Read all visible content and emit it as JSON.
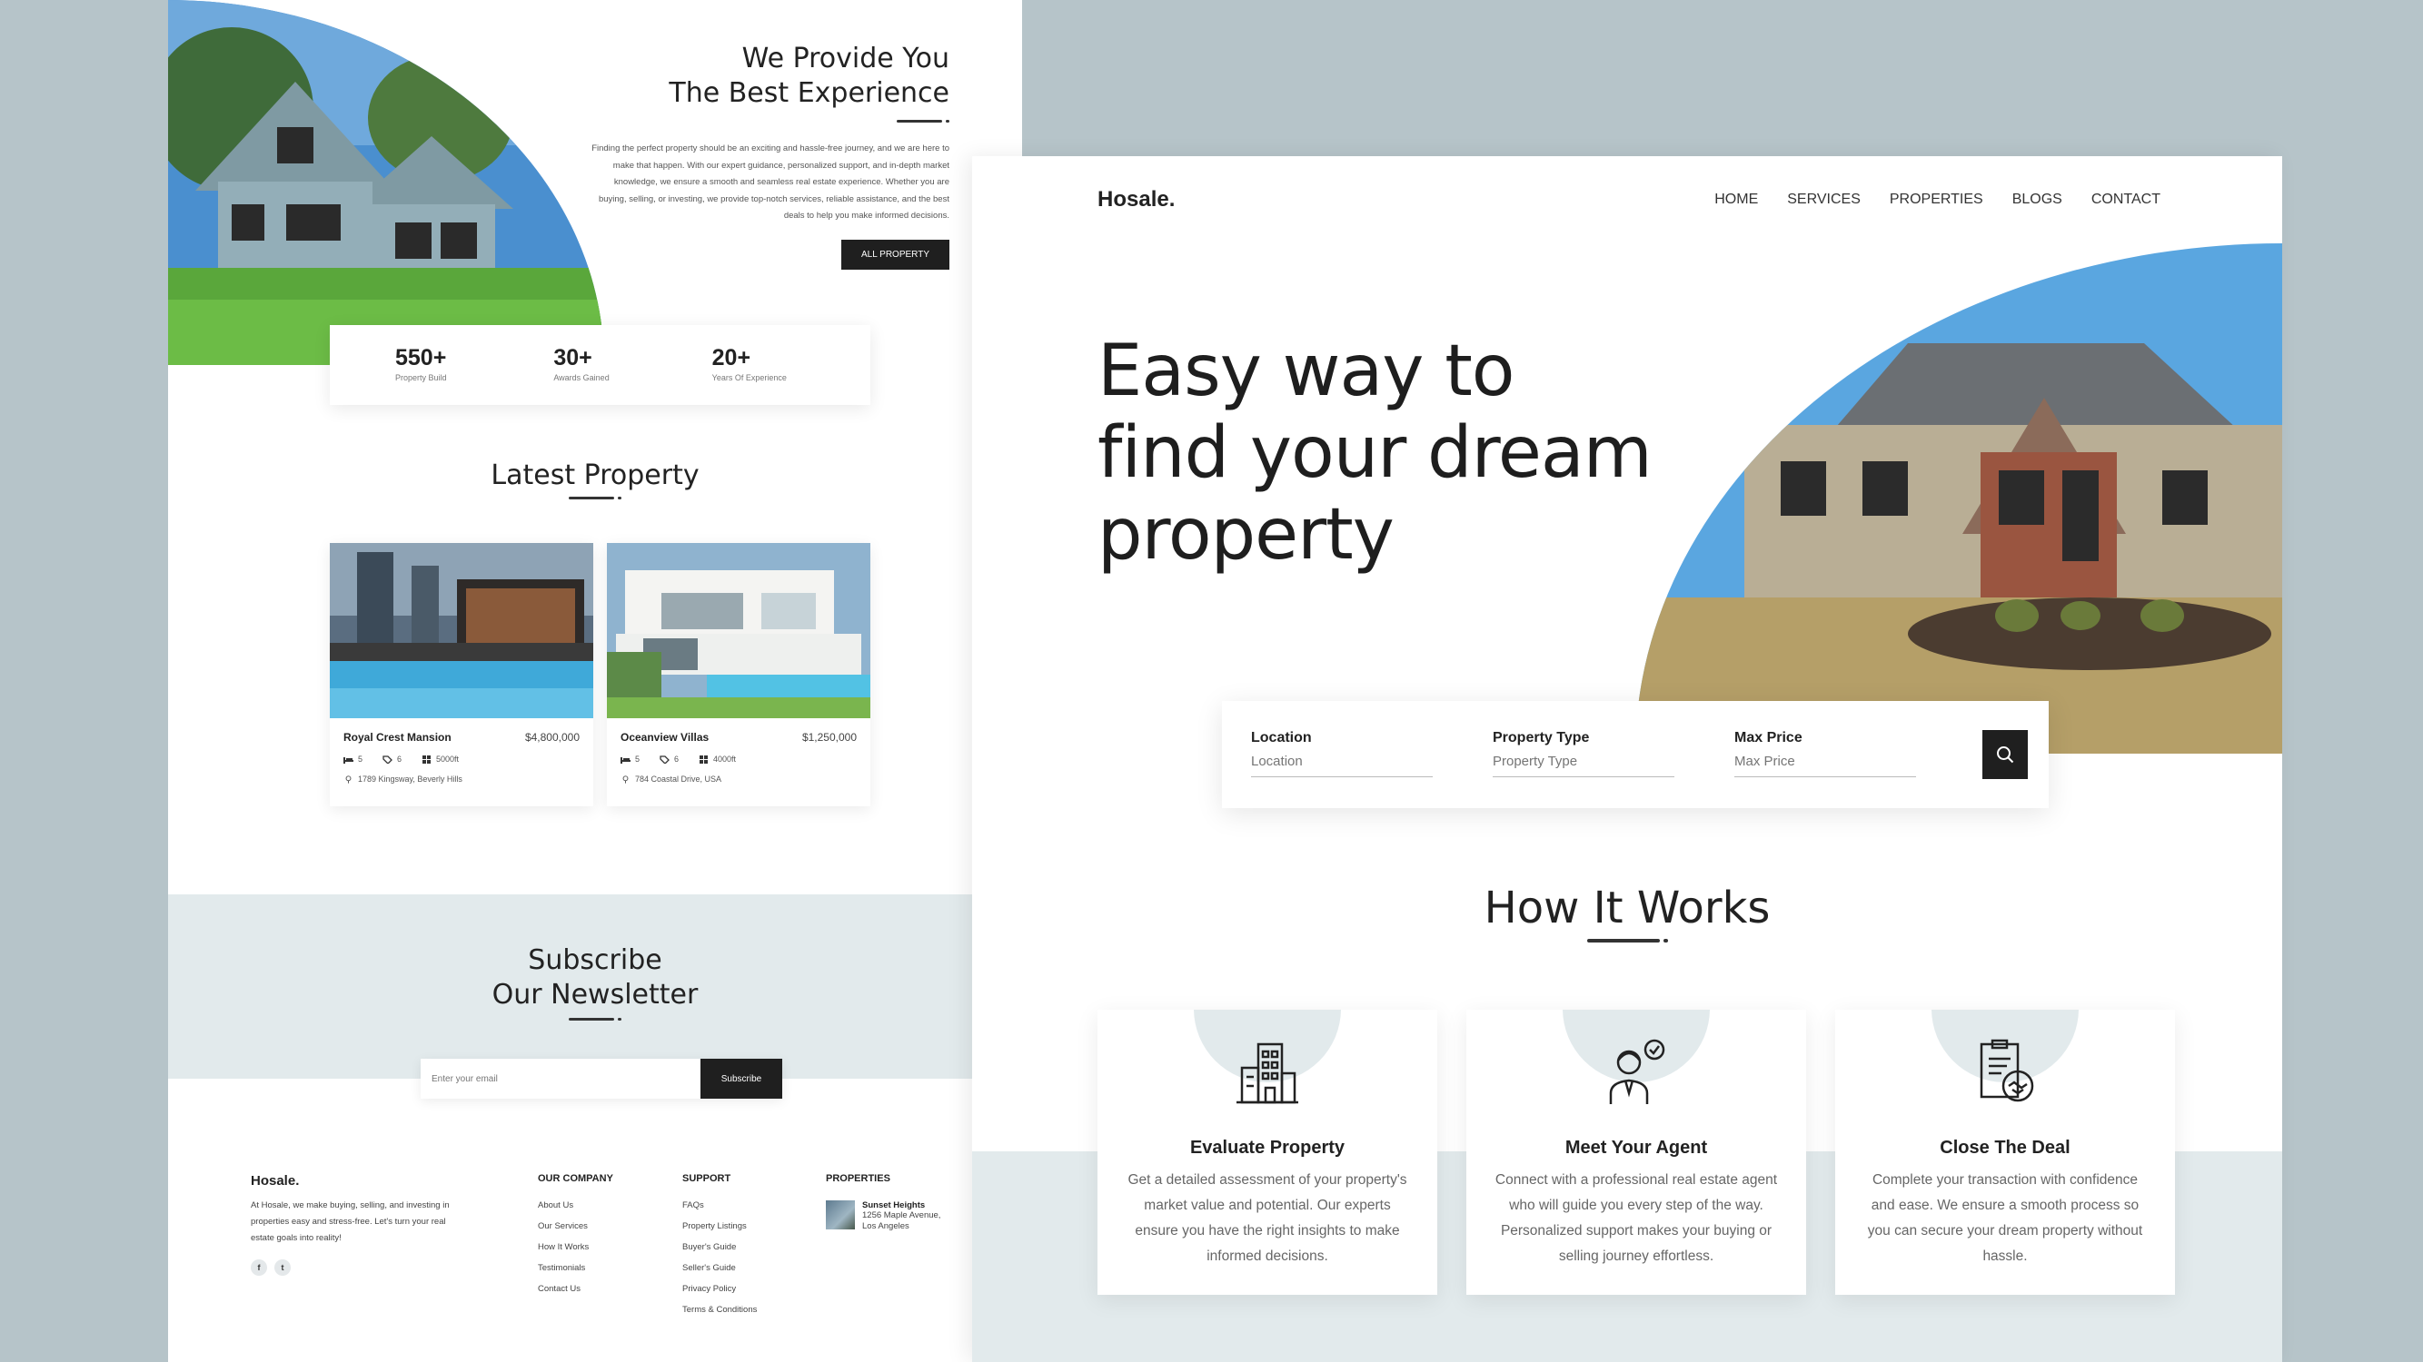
{
  "left_page": {
    "about": {
      "title_line1": "We Provide You",
      "title_line2": "The Best Experience",
      "paragraph": "Finding the perfect property should be an exciting and hassle-free journey, and we are here to make that happen. With our expert guidance, personalized support, and in-depth market knowledge, we ensure a smooth and seamless real estate experience. Whether you are buying, selling, or investing, we provide top-notch services, reliable assistance, and the best deals to help you make informed decisions.",
      "button_label": "ALL PROPERTY"
    },
    "stats": [
      {
        "value": "550+",
        "label": "Property Build"
      },
      {
        "value": "30+",
        "label": "Awards Gained"
      },
      {
        "value": "20+",
        "label": "Years Of Experience"
      }
    ],
    "latest": {
      "title": "Latest Property",
      "cards": [
        {
          "name": "Royal Crest Mansion",
          "price": "$4,800,000",
          "beds": "5",
          "baths": "6",
          "area": "5000ft",
          "address": "1789 Kingsway, Beverly Hills"
        },
        {
          "name": "Oceanview Villas",
          "price": "$1,250,000",
          "beds": "5",
          "baths": "6",
          "area": "4000ft",
          "address": "784 Coastal Drive, USA"
        }
      ]
    },
    "newsletter": {
      "title_line1": "Subscribe",
      "title_line2": "Our Newsletter",
      "placeholder": "Enter your email",
      "button_label": "Subscribe"
    },
    "footer": {
      "logo": "Hosale.",
      "description": "At Hosale, we make buying, selling, and investing in properties easy and stress-free. Let's turn your real estate goals into reality!",
      "social": [
        "f",
        "t"
      ],
      "company": {
        "heading": "OUR COMPANY",
        "links": [
          "About Us",
          "Our Services",
          "How It Works",
          "Testimonials",
          "Contact Us"
        ]
      },
      "support": {
        "heading": "SUPPORT",
        "links": [
          "FAQs",
          "Property Listings",
          "Buyer's Guide",
          "Seller's Guide",
          "Privacy Policy",
          "Terms & Conditions"
        ]
      },
      "properties": {
        "heading": "PROPERTIES",
        "item_title": "Sunset Heights",
        "item_address_line1": "1256 Maple Avenue,",
        "item_address_line2": "Los Angeles"
      }
    }
  },
  "right_page": {
    "logo": "Hosale.",
    "nav": [
      "HOME",
      "SERVICES",
      "PROPERTIES",
      "BLOGS",
      "CONTACT"
    ],
    "headline_line1": "Easy way to",
    "headline_line2": "find your dream",
    "headline_line3": "property",
    "search": {
      "location_label": "Location",
      "location_placeholder": "Location",
      "type_label": "Property Type",
      "type_placeholder": "Property Type",
      "price_label": "Max Price",
      "price_placeholder": "Max Price"
    },
    "how": {
      "title": "How It Works",
      "steps": [
        {
          "icon": "building-icon",
          "title": "Evaluate Property",
          "text": "Get a detailed assessment of your property's market value and potential. Our experts ensure you have the right insights to make informed decisions."
        },
        {
          "icon": "agent-icon",
          "title": "Meet Your Agent",
          "text": "Connect with a professional real estate agent who will guide you every step of the way. Personalized support makes your buying or selling journey effortless."
        },
        {
          "icon": "handshake-document-icon",
          "title": "Close The Deal",
          "text": "Complete your transaction with confidence and ease. We ensure a smooth process so you can secure your dream property without hassle."
        }
      ]
    }
  },
  "colors": {
    "background": "#b6c4c9",
    "accent_light": "#e2eaec",
    "dark": "#1f1f1f"
  }
}
